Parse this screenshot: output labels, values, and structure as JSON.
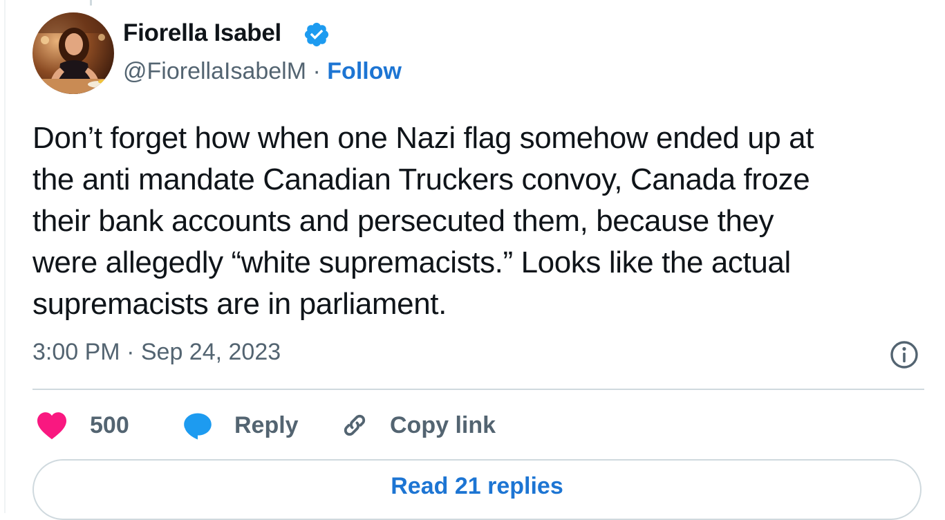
{
  "author": {
    "name": "Fiorella Isabel",
    "handle": "@FiorellaIsabelM",
    "separator": "·",
    "follow_label": "Follow",
    "verified_icon": "verified-badge-icon"
  },
  "tweet": {
    "lines": [
      "Don’t forget how when one Nazi flag somehow ended up at",
      "the anti mandate Canadian Truckers convoy, Canada froze",
      "their bank accounts and persecuted them, because they",
      "were allegedly “white supremacists.”  Looks like the actual",
      "supremacists are in parliament."
    ],
    "time": "3:00 PM",
    "date": "Sep 24, 2023",
    "time_separator": "·"
  },
  "actions": {
    "like_count": "500",
    "reply_label": "Reply",
    "copy_link_label": "Copy link",
    "read_replies_label": "Read 21 replies"
  },
  "colors": {
    "accent_blue": "#1d75d3",
    "like_pink": "#f91880",
    "reply_blue": "#1d9bf0",
    "secondary_text": "#536471",
    "border": "#cfd9de"
  }
}
